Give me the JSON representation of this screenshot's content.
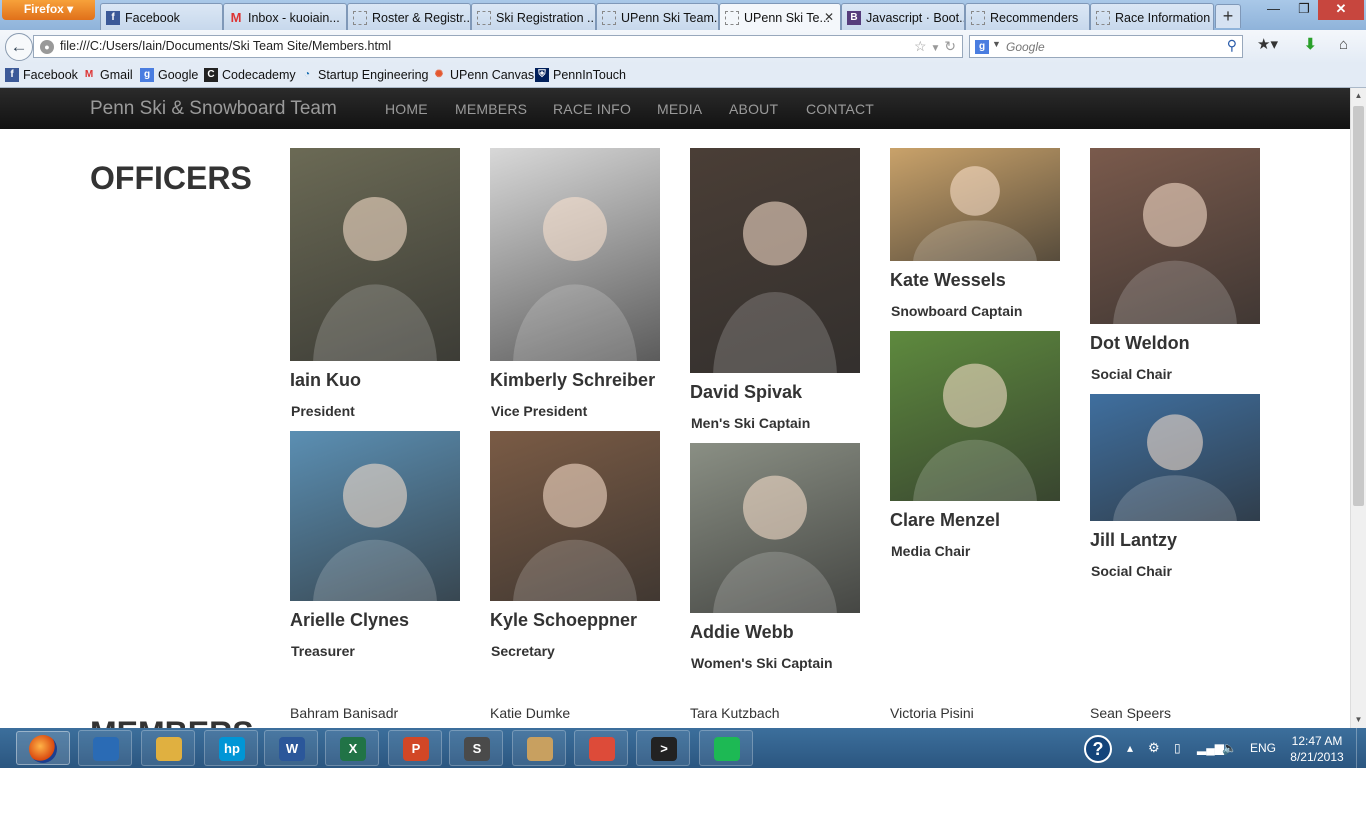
{
  "browser": {
    "app_button": "Firefox",
    "tabs": [
      {
        "title": "Facebook",
        "icon": "facebook-icon"
      },
      {
        "title": "Inbox - kuoiain...",
        "icon": "gmail-icon"
      },
      {
        "title": "Roster & Registr...",
        "icon": "blank-page-icon"
      },
      {
        "title": "Ski Registration ...",
        "icon": "blank-page-icon"
      },
      {
        "title": "UPenn Ski Team...",
        "icon": "blank-page-icon"
      },
      {
        "title": "UPenn Ski Te...",
        "icon": "blank-page-icon",
        "active": true
      },
      {
        "title": "Javascript · Boot...",
        "icon": "bootstrap-icon"
      },
      {
        "title": "Recommenders",
        "icon": "blank-page-icon"
      },
      {
        "title": "Race Information",
        "icon": "blank-page-icon"
      }
    ],
    "url": "file:///C:/Users/Iain/Documents/Ski Team Site/Members.html",
    "search_placeholder": "Google",
    "bookmarks": [
      {
        "label": "Facebook",
        "icon": "facebook-icon"
      },
      {
        "label": "Gmail",
        "icon": "gmail-icon"
      },
      {
        "label": "Google",
        "icon": "google-icon"
      },
      {
        "label": "Codecademy",
        "icon": "codecademy-icon"
      },
      {
        "label": "Startup Engineering",
        "icon": "startup-engineering-icon"
      },
      {
        "label": "UPenn Canvas",
        "icon": "canvas-icon"
      },
      {
        "label": "PennInTouch",
        "icon": "penn-shield-icon"
      }
    ]
  },
  "site": {
    "brand": "Penn Ski & Snowboard Team",
    "nav": [
      "HOME",
      "MEMBERS",
      "RACE INFO",
      "MEDIA",
      "ABOUT",
      "CONTACT"
    ],
    "officers_heading": "OFFICERS",
    "members_heading": "MEMBERS",
    "officers": [
      {
        "name": "Iain Kuo",
        "role": "President",
        "photo": "#6b6a55"
      },
      {
        "name": "Kimberly Schreiber",
        "role": "Vice President",
        "photo": "#d8d8d8"
      },
      {
        "name": "David Spivak",
        "role": "Men's Ski Captain",
        "photo": "#4a3e36"
      },
      {
        "name": "Kate Wessels",
        "role": "Snowboard Captain",
        "photo": "#c9a26a"
      },
      {
        "name": "Dot Weldon",
        "role": "Social Chair",
        "photo": "#7a5a4c"
      },
      {
        "name": "Arielle Clynes",
        "role": "Treasurer",
        "photo": "#5b8fb3"
      },
      {
        "name": "Kyle Schoeppner",
        "role": "Secretary",
        "photo": "#7a5b45"
      },
      {
        "name": "Addie Webb",
        "role": "Women's Ski Captain",
        "photo": "#8a8f84"
      },
      {
        "name": "Clare Menzel",
        "role": "Media Chair",
        "photo": "#5e8a3e"
      },
      {
        "name": "Jill Lantzy",
        "role": "Social Chair",
        "photo": "#3f6f9f"
      }
    ],
    "members_row": [
      "Bahram Banisadr",
      "Katie Dumke",
      "Tara Kutzbach",
      "Victoria Pisini",
      "Sean Speers"
    ]
  },
  "taskbar": {
    "apps": [
      {
        "name": "firefox-icon",
        "color": "#e66000"
      },
      {
        "name": "thunderbird-icon",
        "color": "#2a6bb5"
      },
      {
        "name": "file-explorer-icon",
        "color": "#e0b040"
      },
      {
        "name": "hp-icon",
        "color": "#0096d6",
        "glyph": "hp"
      },
      {
        "name": "word-icon",
        "color": "#2b579a",
        "glyph": "W"
      },
      {
        "name": "excel-icon",
        "color": "#217346",
        "glyph": "X"
      },
      {
        "name": "powerpoint-icon",
        "color": "#d24726",
        "glyph": "P"
      },
      {
        "name": "sublime-text-icon",
        "color": "#4a4a4a",
        "glyph": "S"
      },
      {
        "name": "paint-icon",
        "color": "#c8a060"
      },
      {
        "name": "chrome-icon",
        "color": "#dd4b39"
      },
      {
        "name": "terminal-icon",
        "color": "#222222",
        "glyph": ">"
      },
      {
        "name": "spotify-icon",
        "color": "#1db954"
      }
    ],
    "language": "ENG",
    "time": "12:47 AM",
    "date": "8/21/2013"
  }
}
